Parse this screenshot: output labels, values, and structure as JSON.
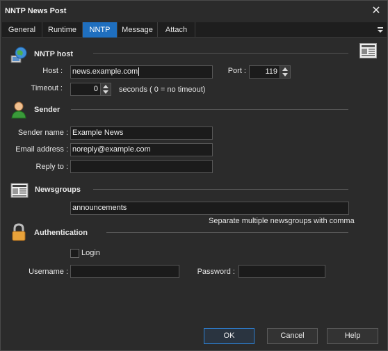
{
  "window": {
    "title": "NNTP News Post"
  },
  "tabs": [
    {
      "label": "General"
    },
    {
      "label": "Runtime"
    },
    {
      "label": "NNTP"
    },
    {
      "label": "Message"
    },
    {
      "label": "Attach"
    }
  ],
  "nntp_host": {
    "title": "NNTP host",
    "host_label": "Host :",
    "host_value": "news.example.com",
    "port_label": "Port :",
    "port_value": "119",
    "timeout_label": "Timeout :",
    "timeout_value": "0",
    "timeout_hint": "seconds ( 0 = no timeout)"
  },
  "sender": {
    "title": "Sender",
    "name_label": "Sender name :",
    "name_value": "Example News",
    "email_label": "Email address :",
    "email_value": "noreply@example.com",
    "reply_label": "Reply to :",
    "reply_value": ""
  },
  "newsgroups": {
    "title": "Newsgroups",
    "value": "announcements",
    "hint": "Separate multiple newsgroups with comma"
  },
  "authentication": {
    "title": "Authentication",
    "login_label": "Login",
    "login_checked": false,
    "username_label": "Username :",
    "username_value": "",
    "password_label": "Password :",
    "password_value": ""
  },
  "footer": {
    "ok": "OK",
    "cancel": "Cancel",
    "help": "Help"
  },
  "colors": {
    "accent": "#1f6fbf",
    "background": "#2b2b2b",
    "field": "#1b1b1b"
  }
}
